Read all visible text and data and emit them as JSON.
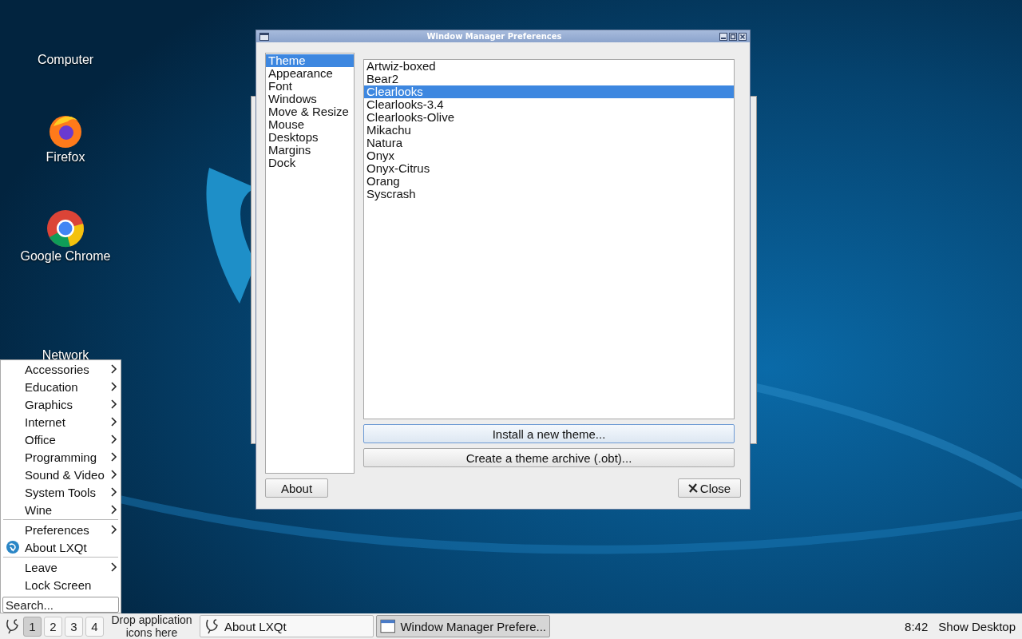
{
  "desktop_icons": [
    {
      "label": "Computer",
      "kind": "none"
    },
    {
      "label": "Firefox",
      "kind": "firefox"
    },
    {
      "label": "Google Chrome",
      "kind": "chrome"
    },
    {
      "label": "Network",
      "kind": "none"
    }
  ],
  "dialog": {
    "title": "Window Manager Preferences",
    "categories": [
      {
        "label": "Theme",
        "selected": true
      },
      {
        "label": "Appearance",
        "selected": false
      },
      {
        "label": "Font",
        "selected": false
      },
      {
        "label": "Windows",
        "selected": false
      },
      {
        "label": "Move & Resize",
        "selected": false
      },
      {
        "label": "Mouse",
        "selected": false
      },
      {
        "label": "Desktops",
        "selected": false
      },
      {
        "label": "Margins",
        "selected": false
      },
      {
        "label": "Dock",
        "selected": false
      }
    ],
    "themes": [
      {
        "label": "Artwiz-boxed",
        "selected": false
      },
      {
        "label": "Bear2",
        "selected": false
      },
      {
        "label": "Clearlooks",
        "selected": true
      },
      {
        "label": "Clearlooks-3.4",
        "selected": false
      },
      {
        "label": "Clearlooks-Olive",
        "selected": false
      },
      {
        "label": "Mikachu",
        "selected": false
      },
      {
        "label": "Natura",
        "selected": false
      },
      {
        "label": "Onyx",
        "selected": false
      },
      {
        "label": "Onyx-Citrus",
        "selected": false
      },
      {
        "label": "Orang",
        "selected": false
      },
      {
        "label": "Syscrash",
        "selected": false
      }
    ],
    "install_button": "Install a new theme...",
    "archive_button": "Create a theme archive (.obt)...",
    "about_button": "About",
    "close_button": "Close"
  },
  "menu": {
    "sections": [
      [
        {
          "label": "Accessories",
          "submenu": true,
          "kind": "plain"
        },
        {
          "label": "Education",
          "submenu": true,
          "kind": "plain"
        },
        {
          "label": "Graphics",
          "submenu": true,
          "kind": "plain"
        },
        {
          "label": "Internet",
          "submenu": true,
          "kind": "plain"
        },
        {
          "label": "Office",
          "submenu": true,
          "kind": "plain"
        },
        {
          "label": "Programming",
          "submenu": true,
          "kind": "plain"
        },
        {
          "label": "Sound & Video",
          "submenu": true,
          "kind": "plain"
        },
        {
          "label": "System Tools",
          "submenu": true,
          "kind": "plain"
        },
        {
          "label": "Wine",
          "submenu": true,
          "kind": "plain"
        }
      ],
      [
        {
          "label": "Preferences",
          "submenu": true,
          "kind": "plain"
        },
        {
          "label": "About LXQt",
          "submenu": false,
          "kind": "logo"
        }
      ],
      [
        {
          "label": "Leave",
          "submenu": true,
          "kind": "plain"
        },
        {
          "label": "Lock Screen",
          "submenu": false,
          "kind": "plain"
        }
      ]
    ],
    "search": {
      "placeholder": "Search..."
    }
  },
  "taskbar": {
    "desktops": [
      {
        "label": "1",
        "selected": true
      },
      {
        "label": "2",
        "selected": false
      },
      {
        "label": "3",
        "selected": false
      },
      {
        "label": "4",
        "selected": false
      }
    ],
    "drop_hint": "Drop application icons here",
    "tasks": [
      {
        "label": "About LXQt",
        "kind": "lxqt",
        "selected": false
      },
      {
        "label": "Window Manager Prefere...",
        "kind": "window",
        "selected": true
      }
    ],
    "clock": "8:42",
    "show_desktop": "Show Desktop"
  }
}
